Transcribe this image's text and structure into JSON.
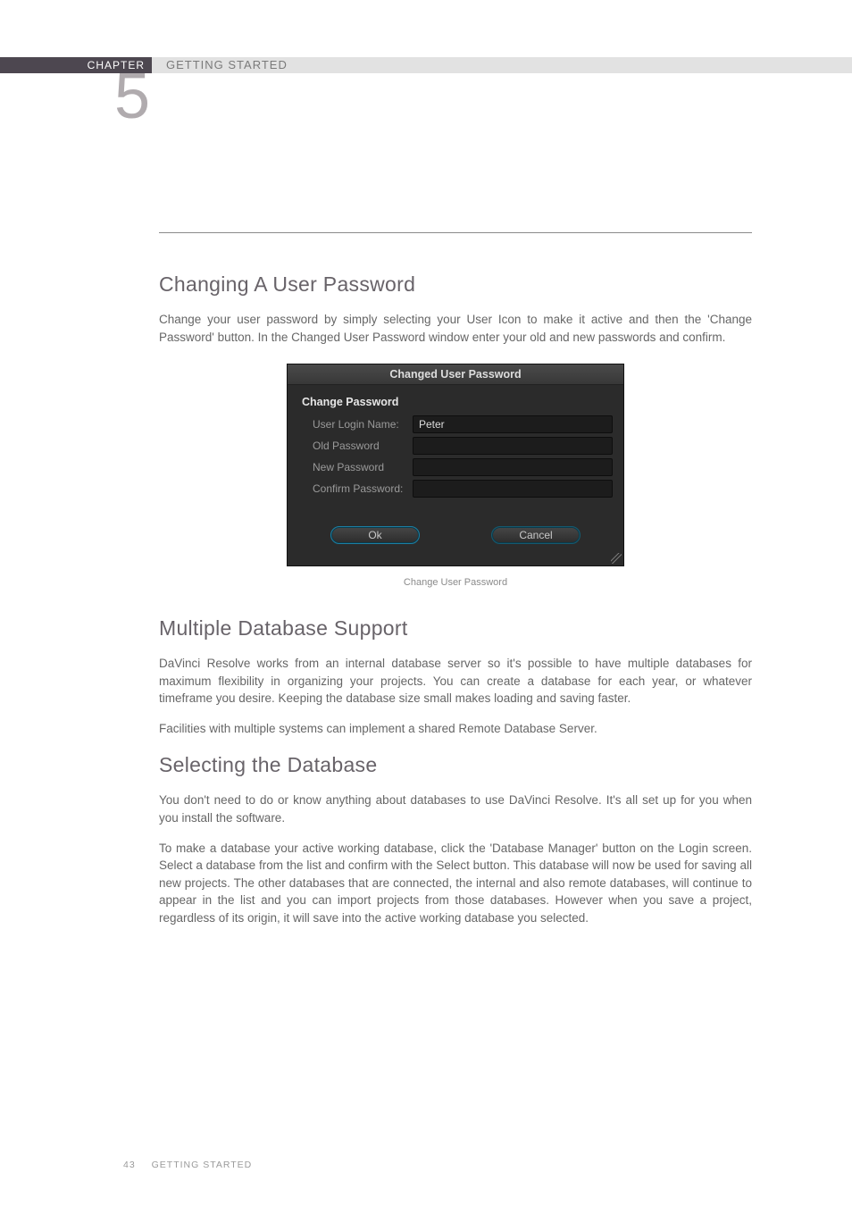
{
  "header": {
    "chapter_label": "CHAPTER",
    "chapter_number": "5",
    "section_name": "GETTING STARTED"
  },
  "sections": {
    "change_pw": {
      "heading": "Changing A User Password",
      "p1": "Change your user password by simply selecting your User Icon to make it active and then the 'Change Password' button. In the Changed User Password window enter your old and new passwords and confirm."
    },
    "multi_db": {
      "heading": "Multiple Database Support",
      "p1": "DaVinci Resolve works from an internal database server so it's possible to have multiple databases for maximum flexibility in organizing your projects. You can create a database for each year, or whatever timeframe you desire. Keeping the database size small makes loading and saving faster.",
      "p2": "Facilities with multiple systems can implement a shared Remote Database Server."
    },
    "select_db": {
      "heading": "Selecting the Database",
      "p1": "You don't need to do or know anything about databases to use DaVinci Resolve. It's all set up for you when you install the software.",
      "p2": "To make a database your active working database, click the 'Database Manager' button on the Login screen. Select a database from the list and confirm with the Select button. This database will now be used for saving all new projects. The other databases that are connected, the internal and also remote databases, will continue to appear in the list and you can import projects from those databases. However when you save a project, regardless of its origin, it will save into the active working database you selected."
    }
  },
  "dialog": {
    "title": "Changed User Password",
    "subtitle": "Change Password",
    "labels": {
      "user_login": "User Login Name:",
      "old_pw": "Old Password",
      "new_pw": "New Password",
      "confirm_pw": "Confirm Password:"
    },
    "values": {
      "user_login": "Peter",
      "old_pw": "",
      "new_pw": "",
      "confirm_pw": ""
    },
    "buttons": {
      "ok": "Ok",
      "cancel": "Cancel"
    },
    "caption": "Change User Password"
  },
  "footer": {
    "page_number": "43",
    "running_title": "GETTING STARTED"
  }
}
